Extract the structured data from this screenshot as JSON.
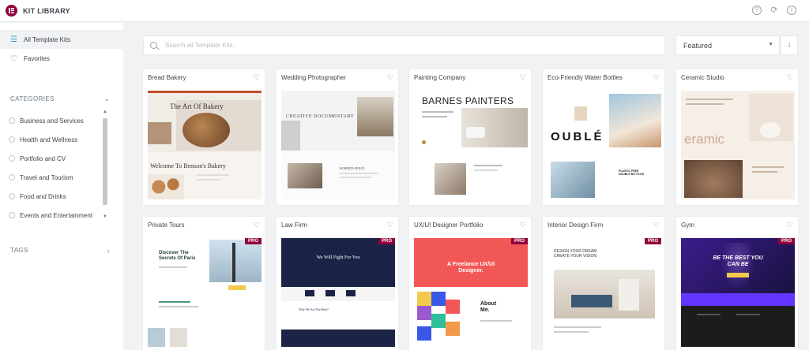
{
  "header": {
    "title": "KIT LIBRARY",
    "icons": [
      "help-icon",
      "sync-icon",
      "info-icon"
    ]
  },
  "sidebar": {
    "all_label": "All Template Kits",
    "favorites_label": "Favorites",
    "categories_label": "CATEGORIES",
    "categories": [
      "Business and Services",
      "Health and Wellness",
      "Portfolio and CV",
      "Travel and Tourism",
      "Food and Drinks",
      "Events and Entertainment"
    ],
    "tags_label": "TAGS"
  },
  "search": {
    "placeholder": "Search all Template Kits..."
  },
  "sort": {
    "selected": "Featured"
  },
  "colors": {
    "brand": "#92003b",
    "accent": "#20a7c4",
    "pro": "#93003c"
  },
  "kits": [
    {
      "title": "Bread Bakery",
      "thumb": {
        "heading": "The Art Of Bakery",
        "subheading": "Welcome To Benson's Bakery"
      }
    },
    {
      "title": "Wedding Photographer",
      "thumb": {
        "heading": "CREATIVE DOCUMENTARY",
        "subheading": "ROBERTA SENCE"
      }
    },
    {
      "title": "Painting Company",
      "thumb": {
        "heading": "BARNES PAINTERS"
      }
    },
    {
      "title": "Eco-Friendly Water Bottles",
      "thumb": {
        "heading": "OUBLÉ",
        "subheading": "PLASTIC FREE DOUBLE BOTTLES"
      }
    },
    {
      "title": "Ceramic Studio",
      "thumb": {
        "heading": "eramic"
      }
    },
    {
      "title": "Private Tours",
      "pro": "PRO",
      "thumb": {
        "heading": "Discover The Secrets Of Paris"
      }
    },
    {
      "title": "Law Firm",
      "pro": "PRO",
      "thumb": {
        "heading": "We Will Fight For You",
        "subheading": "Why We Are The Best?"
      }
    },
    {
      "title": "UX/UI Designer Portfolio",
      "pro": "PRO",
      "thumb": {
        "heading": "A Freelance UX/UI Designer.",
        "subheading": "About Me."
      }
    },
    {
      "title": "Interior Design Firm",
      "pro": "PRO",
      "thumb": {
        "heading": "DESIGN YOUR DREAM CREATE YOUR VISION."
      }
    },
    {
      "title": "Gym",
      "pro": "PRO",
      "thumb": {
        "heading": "BE THE BEST YOU CAN BE"
      }
    }
  ]
}
